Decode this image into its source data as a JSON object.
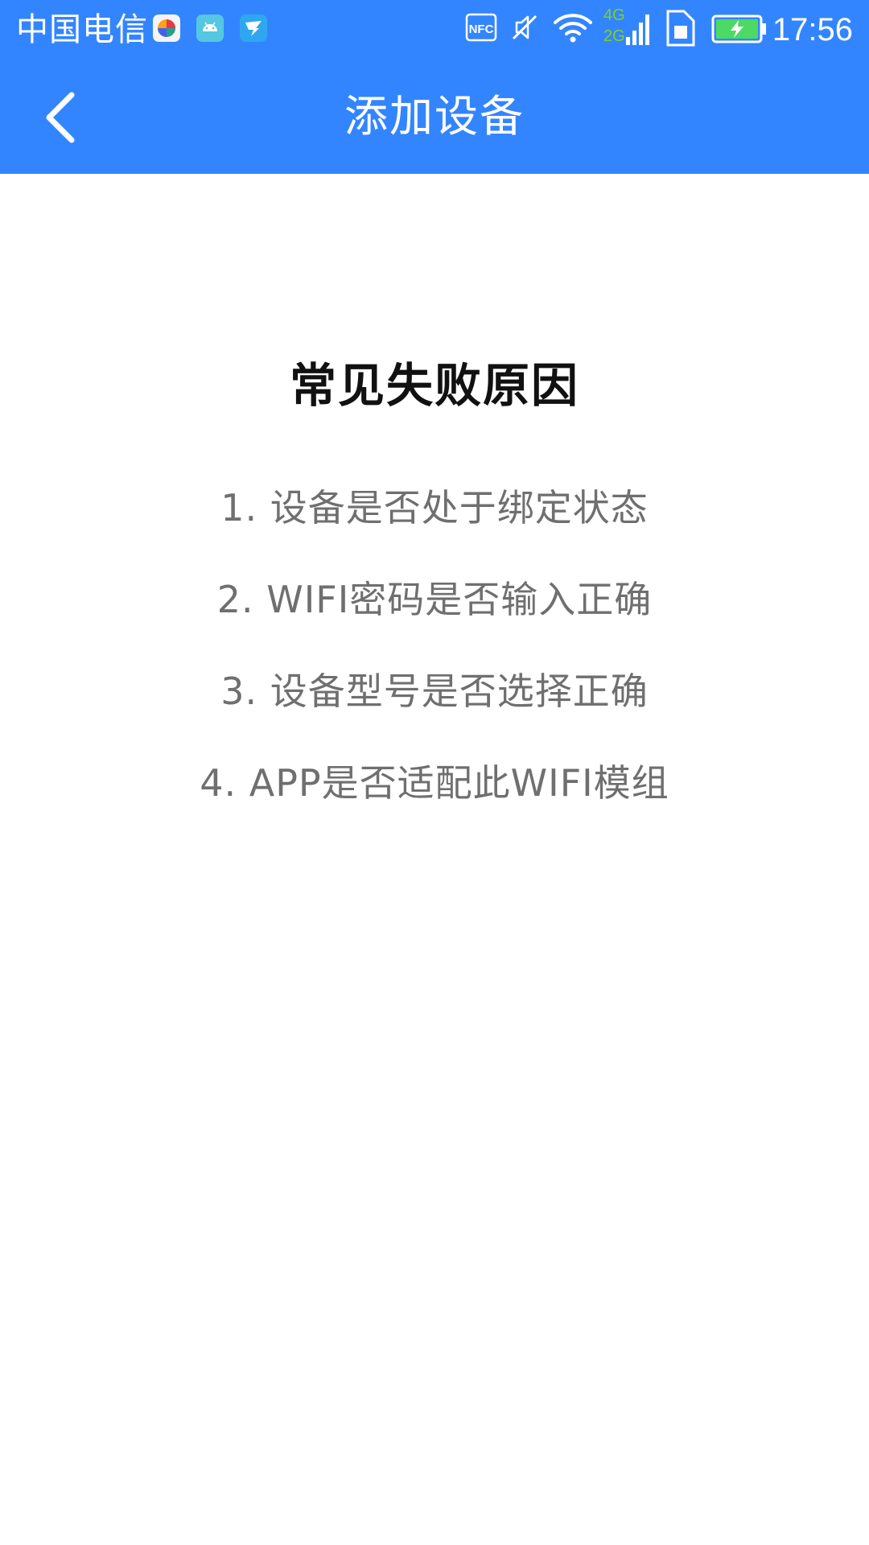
{
  "status_bar": {
    "carrier": "中国电信",
    "nfc_label": "NFC",
    "network_4g": "4G",
    "network_2g": "2G",
    "time": "17:56",
    "app_icons": [
      "browser-app-icon",
      "android-app-icon",
      "dingtalk-app-icon"
    ],
    "right_icons": [
      "nfc-icon",
      "mute-icon",
      "wifi-icon",
      "signal-icon",
      "sim-icon",
      "battery-charging-icon"
    ]
  },
  "header": {
    "back_icon": "chevron-left-icon",
    "title": "添加设备"
  },
  "content": {
    "heading": "常见失败原因",
    "reasons": [
      "1. 设备是否处于绑定状态",
      "2. WIFI密码是否输入正确",
      "3. 设备型号是否选择正确",
      "4. APP是否适配此WIFI模组"
    ]
  },
  "colors": {
    "primary": "#3385ff",
    "heading_text": "#111111",
    "list_text": "#6f6f6f",
    "background": "#ffffff",
    "network_accent": "#7ed321",
    "battery_fill": "#4cd964"
  }
}
